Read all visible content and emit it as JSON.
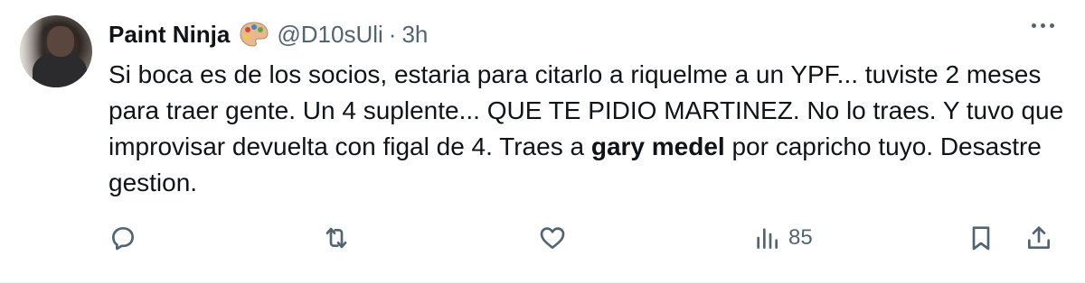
{
  "tweet": {
    "author_name": "Paint Ninja",
    "author_emoji_icon": "artist-palette-icon",
    "handle": "@D10sUli",
    "separator": "·",
    "time": "3h",
    "text_part1": "Si boca es de los socios, estaria para citarlo a riquelme a un YPF... tuviste 2 meses para traer gente. Un 4 suplente... QUE TE PIDIO MARTINEZ. No lo traes. Y tuvo que improvisar devuelta con figal de 4. Traes a ",
    "text_bold": "gary medel",
    "text_part2": " por capricho tuyo. Desastre gestion."
  },
  "actions": {
    "reply_icon": "reply-icon",
    "retweet_icon": "retweet-icon",
    "like_icon": "heart-icon",
    "views_icon": "views-icon",
    "views_count": "85",
    "bookmark_icon": "bookmark-icon",
    "share_icon": "share-icon"
  },
  "colors": {
    "text": "#0f1419",
    "secondary": "#536471",
    "divider": "#eff3f4"
  }
}
